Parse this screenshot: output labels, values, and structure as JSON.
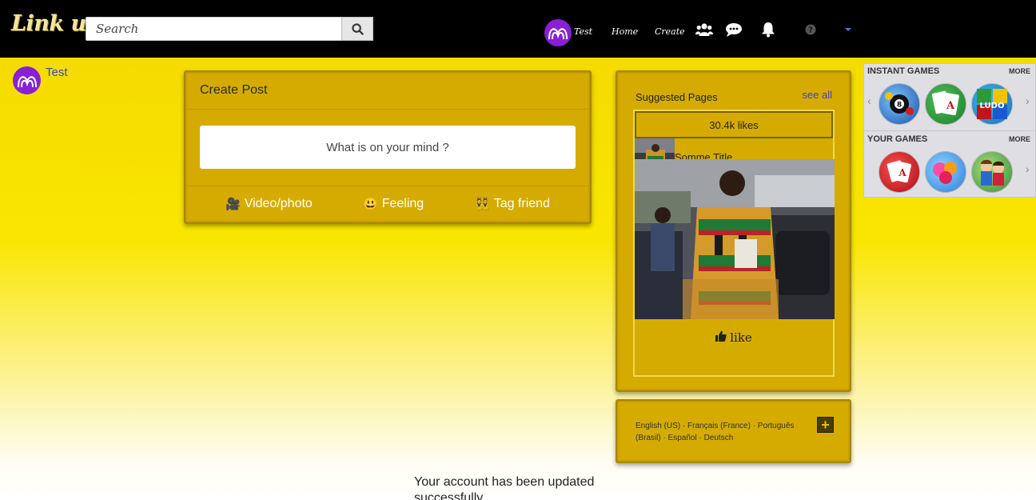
{
  "nav": {
    "logo_text": "Link up",
    "search_placeholder": "Search",
    "user_name": "Test",
    "home_label": "Home",
    "create_label": "Create"
  },
  "left": {
    "user_name": "Test"
  },
  "create_post": {
    "title": "Create Post",
    "prompt": "What is on your mind ?",
    "actions": [
      {
        "label": "Video/photo",
        "icon": "video-camera-icon",
        "glyph": "🎥"
      },
      {
        "label": "Feeling",
        "icon": "smiley-icon",
        "glyph": "😃"
      },
      {
        "label": "Tag friend",
        "icon": "people-icon",
        "glyph": "👯"
      }
    ]
  },
  "suggested": {
    "title": "Suggested Pages",
    "see_all": "see all",
    "likes": "30.4k likes",
    "page_name": "Somme Title",
    "like_label": "like"
  },
  "languages": {
    "text": "English (US) · Français (France) · Português (Brasil) · Español · Deutsch",
    "plus_label": "+"
  },
  "games": {
    "instant_title": "INSTANT GAMES",
    "your_title": "YOUR GAMES",
    "more_label": "MORE",
    "instant": [
      "8-ball-pool-icon",
      "solitaire-icon",
      "ludo-icon"
    ],
    "yours": [
      "poker-icon",
      "candy-icon",
      "farm-characters-icon"
    ]
  },
  "status_message": "Your account has been updated successfully",
  "colors": {
    "accent_purple": "#8a1fd6",
    "panel_gold": "#d6ab00",
    "link_blue": "#4a3bd0",
    "nav_black": "#000000"
  }
}
